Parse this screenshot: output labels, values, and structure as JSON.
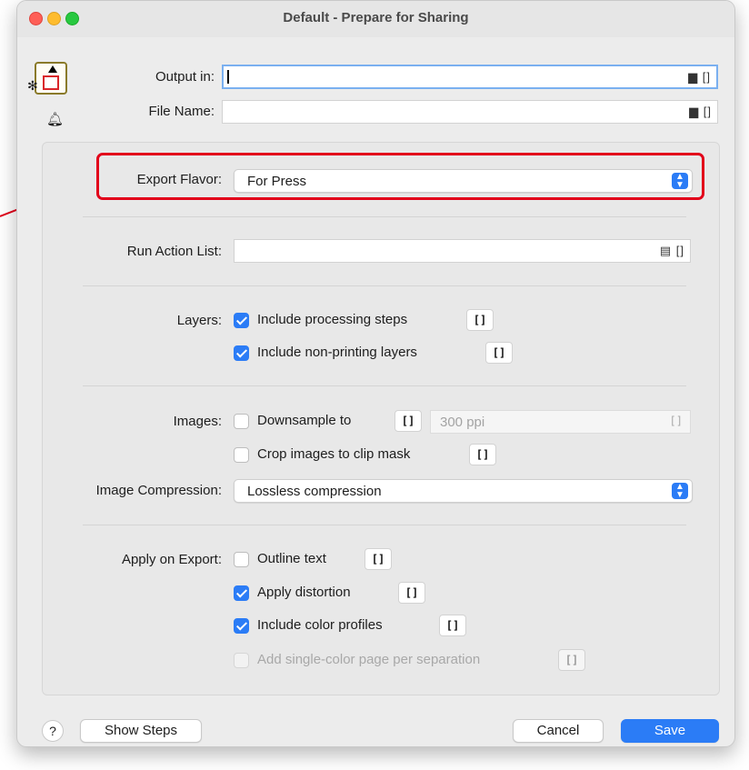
{
  "window": {
    "title": "Default - Prepare for Sharing"
  },
  "header": {
    "output_in_label": "Output in:",
    "output_in_value": "",
    "output_in_icons": "▆ []",
    "file_name_label": "File Name:",
    "file_name_value": "",
    "file_name_icons": "▆ []"
  },
  "export_flavor": {
    "label": "Export Flavor:",
    "value": "For Press"
  },
  "run_action_list": {
    "label": "Run Action List:",
    "value": "",
    "icons": "▤ []"
  },
  "layers": {
    "label": "Layers:",
    "include_processing_steps": {
      "label": "Include processing steps",
      "checked": true
    },
    "include_non_printing_layers": {
      "label": "Include non-printing layers",
      "checked": true
    }
  },
  "images": {
    "label": "Images:",
    "downsample_to": {
      "label": "Downsample to",
      "checked": false
    },
    "ppi_placeholder": "300 ppi",
    "crop_images": {
      "label": "Crop images to clip mask",
      "checked": false
    }
  },
  "image_compression": {
    "label": "Image Compression:",
    "value": "Lossless compression"
  },
  "apply_on_export": {
    "label": "Apply on Export:",
    "outline_text": {
      "label": "Outline text",
      "checked": false
    },
    "apply_distortion": {
      "label": "Apply distortion",
      "checked": true
    },
    "include_color_profiles": {
      "label": "Include color profiles",
      "checked": true
    },
    "add_single_color_page": {
      "label": "Add single-color page per separation",
      "checked": false,
      "disabled": true
    }
  },
  "variable_chip": "[]",
  "footer": {
    "help": "?",
    "show_steps": "Show Steps",
    "cancel": "Cancel",
    "save": "Save"
  },
  "colors": {
    "accent": "#2b7cf6",
    "highlight": "#e2001a"
  }
}
